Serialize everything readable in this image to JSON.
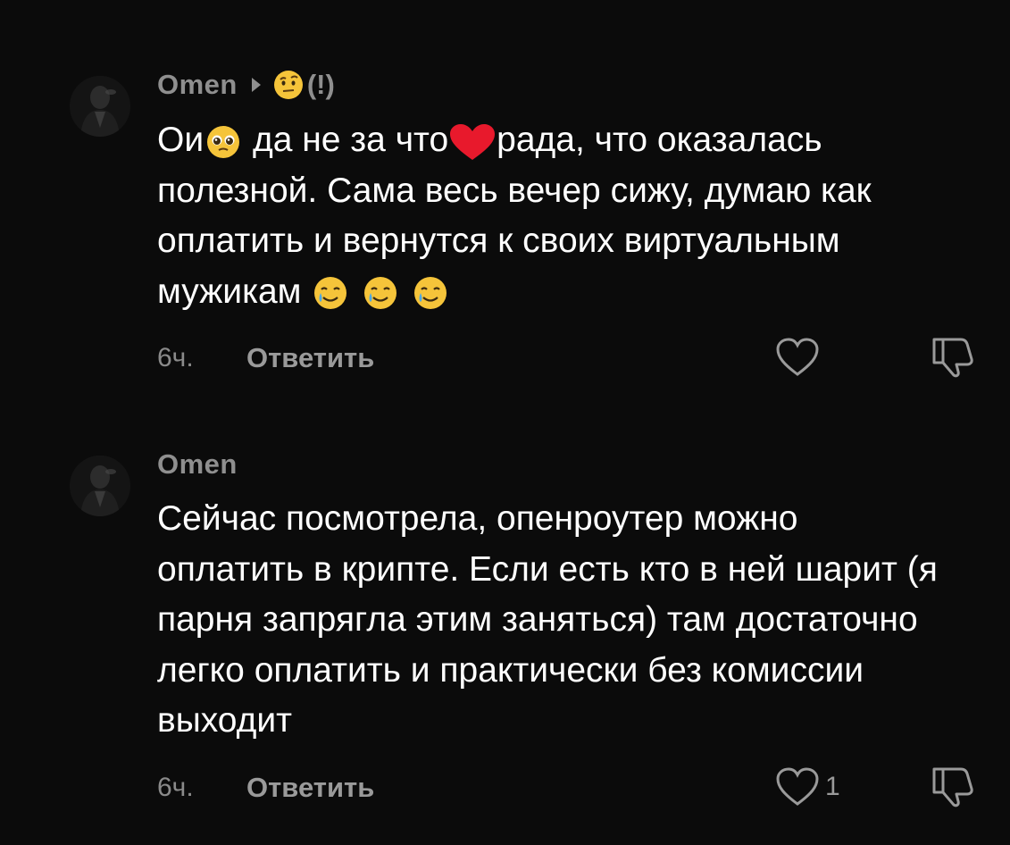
{
  "comments": [
    {
      "author": "Omen",
      "reply_to": "(!)",
      "text_parts": [
        "Ои",
        " да не за что",
        "рада, что оказалась полезной. Сама весь вечер сижу, думаю как оплатить и вернутся к своих виртуальным мужикам "
      ],
      "time": "6ч.",
      "reply_label": "Ответить",
      "likes": ""
    },
    {
      "author": "Omen",
      "text": "Сейчас посмотрела, опенроутер можно оплатить в крипте. Если есть кто в ней шарит (я парня запрягла этим заняться) там достаточно легко оплатить и практически без комиссии выходит",
      "time": "6ч.",
      "reply_label": "Ответить",
      "likes": "1"
    }
  ],
  "icons": {
    "avatar": "avatar-image",
    "reply_arrow": "triangle-right-icon",
    "raised_eyebrow": "face-with-raised-eyebrow-emoji",
    "pleading": "pleading-face-emoji",
    "heart": "red-heart-emoji",
    "tear": "smiling-face-with-tear-emoji",
    "like": "heart-outline-icon",
    "dislike": "thumbs-down-icon"
  },
  "colors": {
    "background": "#0b0b0b",
    "primary_text": "#ffffff",
    "secondary_text": "#8f8f8f",
    "emoji_yellow": "#f5c43a",
    "heart_red": "#e8192c"
  }
}
